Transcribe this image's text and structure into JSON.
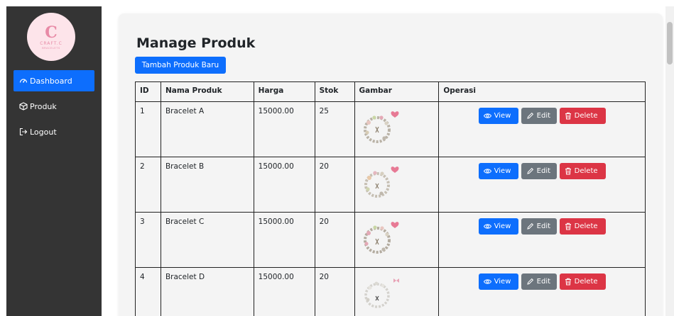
{
  "sidebar": {
    "logo": {
      "mark": "C",
      "brand": "CRAFT.C",
      "tagline": "BRACELETS"
    },
    "items": [
      {
        "label": "Dashboard",
        "icon": "dashboard-icon",
        "active": true
      },
      {
        "label": "Produk",
        "icon": "box-icon",
        "active": false
      },
      {
        "label": "Logout",
        "icon": "logout-icon",
        "active": false
      }
    ]
  },
  "main": {
    "title": "Manage Produk",
    "add_button": "Tambah Produk Baru",
    "table": {
      "headers": [
        "ID",
        "Nama Produk",
        "Harga",
        "Stok",
        "Gambar",
        "Operasi"
      ],
      "rows": [
        {
          "id": "1",
          "name": "Bracelet A",
          "price": "15000.00",
          "stock": "25"
        },
        {
          "id": "2",
          "name": "Bracelet B",
          "price": "15000.00",
          "stock": "20"
        },
        {
          "id": "3",
          "name": "Bracelet C",
          "price": "15000.00",
          "stock": "20"
        },
        {
          "id": "4",
          "name": "Bracelet D",
          "price": "15000.00",
          "stock": "20"
        }
      ]
    },
    "operations": {
      "view": "View",
      "edit": "Edit",
      "delete": "Delete"
    }
  },
  "colors": {
    "primary": "#0d6efd",
    "secondary": "#6c757d",
    "danger": "#dc3545",
    "sidebar_bg": "#343434"
  }
}
